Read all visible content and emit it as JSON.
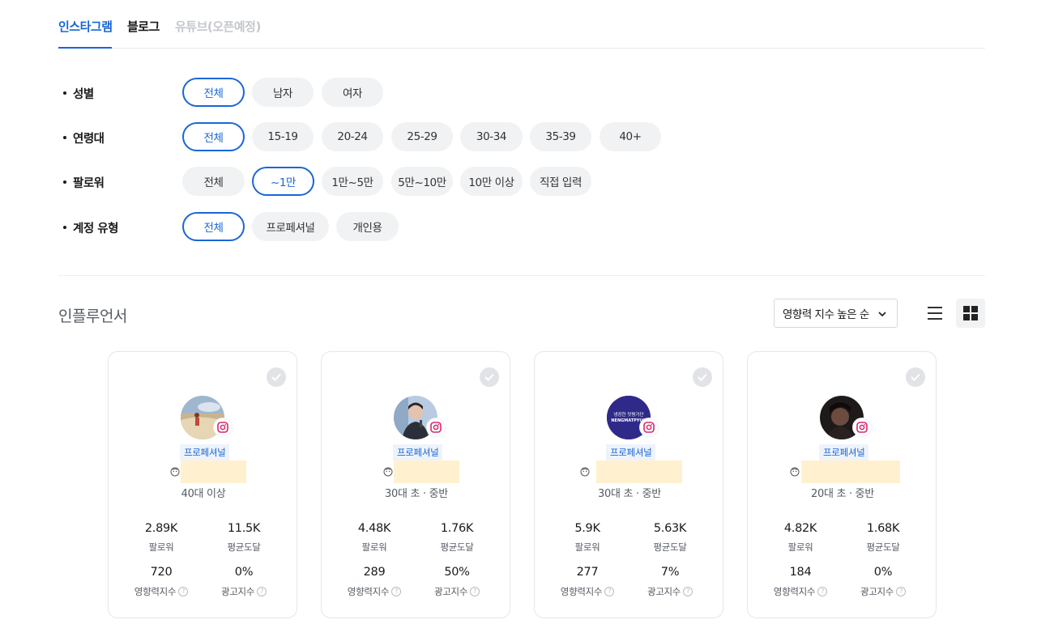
{
  "tabs": [
    {
      "label": "인스타그램",
      "state": "active"
    },
    {
      "label": "블로그",
      "state": "normal"
    },
    {
      "label": "유튜브(오픈예정)",
      "state": "disabled"
    }
  ],
  "filters": [
    {
      "label": "성별",
      "options": [
        "전체",
        "남자",
        "여자"
      ],
      "selected": "전체"
    },
    {
      "label": "연령대",
      "options": [
        "전체",
        "15-19",
        "20-24",
        "25-29",
        "30-34",
        "35-39",
        "40+"
      ],
      "selected": "전체"
    },
    {
      "label": "팔로워",
      "options": [
        "전체",
        "~1만",
        "1만~5만",
        "5만~10만",
        "10만 이상",
        "직접 입력"
      ],
      "selected": "~1만"
    },
    {
      "label": "계정 유형",
      "options": [
        "전체",
        "프로페셔널",
        "개인용"
      ],
      "selected": "전체"
    }
  ],
  "section": {
    "title": "인플루언서",
    "sort_label": "영향력 지수 높은 순"
  },
  "stat_labels": {
    "followers": "팔로워",
    "avg_reach": "평균도달",
    "influence": "영향력지수",
    "ad": "광고지수"
  },
  "cards": [
    {
      "badge": "프로페셔널",
      "age": "40대 이상",
      "followers": "2.89K",
      "avg_reach": "11.5K",
      "influence": "720",
      "ad": "0%",
      "avatar": "beach-photo"
    },
    {
      "badge": "프로페셔널",
      "age": "30대 초 · 중반",
      "followers": "4.48K",
      "avg_reach": "1.76K",
      "influence": "289",
      "ad": "50%",
      "avatar": "portrait-photo"
    },
    {
      "badge": "프로페셔널",
      "age": "30대 초 · 중반",
      "followers": "5.9K",
      "avg_reach": "5.63K",
      "influence": "277",
      "ad": "7%",
      "avatar": "logo-photo",
      "avatar_text_top": "냉장한 맛평가단",
      "avatar_text_bottom": "NENGMATPYUN"
    },
    {
      "badge": "프로페셔널",
      "age": "20대 초 · 중반",
      "followers": "4.82K",
      "avg_reach": "1.68K",
      "influence": "184",
      "ad": "0%",
      "avatar": "dark-photo"
    }
  ],
  "colors": {
    "accent": "#1a66d6",
    "chip_bg": "#f1f2f4",
    "name_mask": "#fff1cf"
  }
}
